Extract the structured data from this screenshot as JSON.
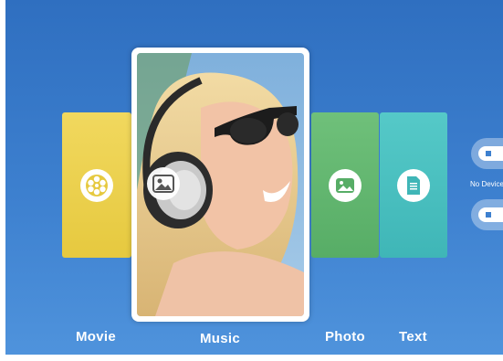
{
  "menu": {
    "items": [
      {
        "label": "Movie",
        "icon": "film-reel-icon"
      },
      {
        "label": "Music",
        "icon": "image-icon"
      },
      {
        "label": "Photo",
        "icon": "image-icon"
      },
      {
        "label": "Text",
        "icon": "document-icon"
      }
    ],
    "selected": "Music"
  },
  "devices": {
    "status": "No Device",
    "slots": [
      {
        "icon": "usb-icon"
      },
      {
        "icon": "usb-icon"
      }
    ]
  },
  "colors": {
    "background": "#3d80cf",
    "movie": "#e8cc45",
    "photo": "#5fb56e",
    "text": "#48bfbf"
  }
}
